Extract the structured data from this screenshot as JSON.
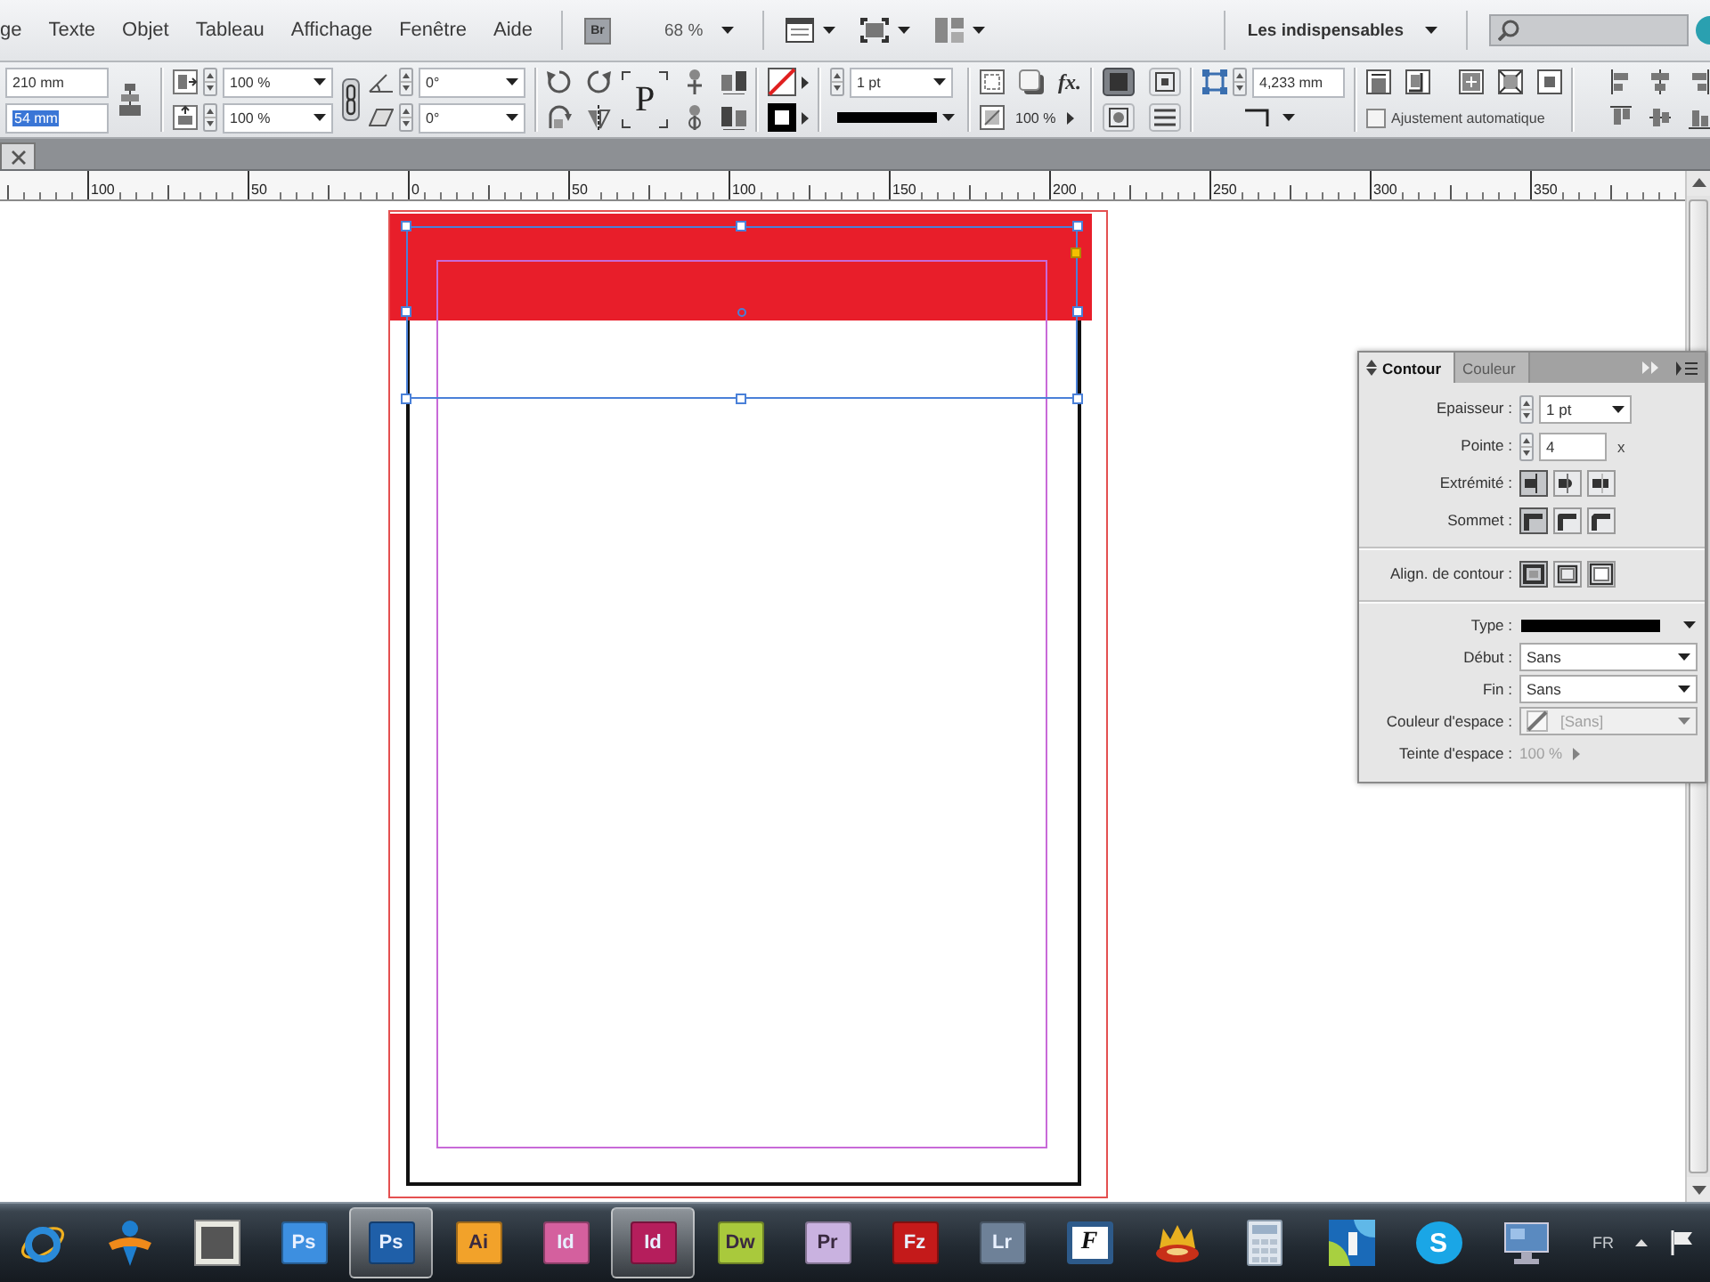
{
  "menu_bar": {
    "items": [
      "ge",
      "Texte",
      "Objet",
      "Tableau",
      "Affichage",
      "Fenêtre",
      "Aide"
    ],
    "launcher": "Br",
    "zoom": "68 %",
    "workspace": "Les indispensables"
  },
  "control_panel": {
    "size_fields": [
      {
        "value": "210 mm",
        "highlighted": false
      },
      {
        "value": "54 mm",
        "highlighted": true
      }
    ],
    "scale_fields": [
      "100 %",
      "100 %"
    ],
    "angle_fields": [
      "0°",
      "0°"
    ],
    "frame_label": "P",
    "stroke_weight": "1 pt",
    "effects_label": "fx.",
    "opacity": "100 %",
    "wrap_options": [
      {
        "selected": true
      },
      {
        "selected": false
      },
      {
        "selected": false
      },
      {
        "selected": false
      }
    ],
    "corner_size": "4,233 mm",
    "auto_fit": {
      "label": "Ajustement automatique",
      "checked": false
    }
  },
  "ruler": {
    "labels": [
      "100",
      "50",
      "0",
      "50",
      "100",
      "150",
      "200",
      "250",
      "300",
      "350"
    ]
  },
  "stroke_panel": {
    "tabs": [
      {
        "label": "Contour",
        "selected": true
      },
      {
        "label": "Couleur",
        "selected": false
      }
    ],
    "sections": [
      [
        {
          "kind": "weight",
          "label": "Epaisseur :",
          "value": "1 pt",
          "disabled": false
        },
        {
          "kind": "miter",
          "label": "Pointe :",
          "value": "4",
          "unit": "x",
          "disabled": false
        },
        {
          "kind": "caps",
          "label": "Extrémité :",
          "options": [
            {
              "selected": true
            },
            {
              "selected": false
            },
            {
              "selected": false
            }
          ],
          "disabled": false
        },
        {
          "kind": "joins",
          "label": "Sommet :",
          "options": [
            {
              "selected": true
            },
            {
              "selected": false
            },
            {
              "selected": false
            }
          ],
          "disabled": false
        }
      ],
      [
        {
          "kind": "alignment",
          "label": "Align. de contour :",
          "options": [
            {
              "selected": true
            },
            {
              "selected": false
            },
            {
              "selected": false
            }
          ],
          "disabled": false
        }
      ],
      [
        {
          "kind": "line",
          "label": "Type :",
          "disabled": false
        },
        {
          "kind": "select",
          "label": "Début :",
          "value": "Sans",
          "disabled": false
        },
        {
          "kind": "select",
          "label": "Fin :",
          "value": "Sans",
          "disabled": false
        },
        {
          "kind": "swatch",
          "label": "Couleur d'espace :",
          "value": "[Sans]",
          "disabled": true
        },
        {
          "kind": "tint",
          "label": "Teinte d'espace :",
          "value": "100 %",
          "disabled": true
        }
      ]
    ]
  },
  "taskbar": {
    "apps": [
      {
        "kind": "globe",
        "active": false
      },
      {
        "kind": "figure",
        "active": false
      },
      {
        "kind": "picture",
        "active": false
      },
      {
        "kind": "tile",
        "label": "Ps",
        "color": "#3d8fe0",
        "active": false
      },
      {
        "kind": "tile",
        "label": "Ps",
        "color": "#1f5fa8",
        "active": true
      },
      {
        "kind": "tile",
        "label": "Ai",
        "color": "#f2a22a",
        "active": false
      },
      {
        "kind": "tile",
        "label": "Id",
        "color": "#d4609e",
        "active": false
      },
      {
        "kind": "tile",
        "label": "Id",
        "color": "#b51e5c",
        "active": true
      },
      {
        "kind": "tile",
        "label": "Dw",
        "color": "#a9c93c",
        "active": false
      },
      {
        "kind": "tile",
        "label": "Pr",
        "color": "#c9b2e0",
        "active": false
      },
      {
        "kind": "tile",
        "label": "Fz",
        "color": "#c41a1a",
        "active": false
      },
      {
        "kind": "tile",
        "label": "Lr",
        "color": "#6e8198",
        "active": false
      },
      {
        "kind": "framed",
        "label": "F",
        "color": "#2d5a8a",
        "active": false
      },
      {
        "kind": "crown",
        "active": false
      },
      {
        "kind": "calculator",
        "active": false
      },
      {
        "kind": "shapes",
        "active": false
      },
      {
        "kind": "bubble",
        "label": "S",
        "color": "#1aa6e6",
        "active": false
      },
      {
        "kind": "monitor",
        "active": false
      }
    ],
    "language": "FR"
  }
}
